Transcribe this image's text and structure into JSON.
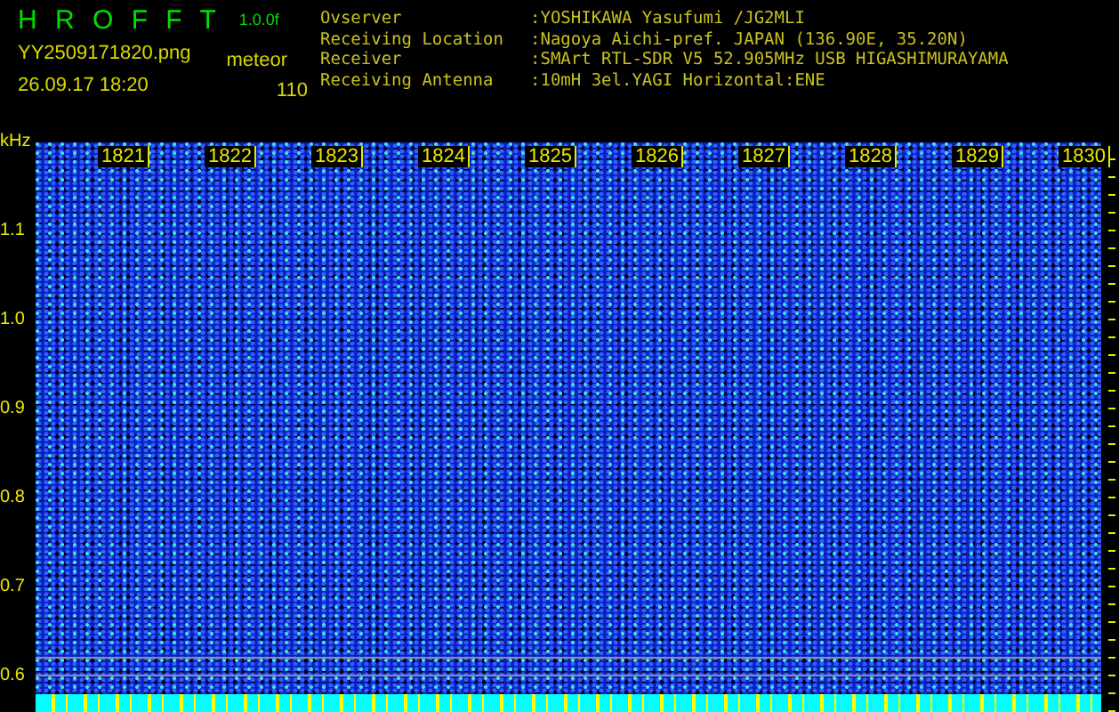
{
  "app": {
    "title": "H R O F F T",
    "version": "1.0.0f",
    "filename": "YY2509171820.png",
    "mode": "meteor",
    "datetime": "26.09.17 18:20",
    "count": "110"
  },
  "info": [
    {
      "label": "Ovserver",
      "value": ":YOSHIKAWA Yasufumi /JG2MLI"
    },
    {
      "label": "Receiving Location",
      "value": ":Nagoya Aichi-pref. JAPAN (136.90E, 35.20N)"
    },
    {
      "label": "Receiver",
      "value": ":SMArt RTL-SDR V5 52.905MHz USB HIGASHIMURAYAMA"
    },
    {
      "label": "Receiving Antenna",
      "value": ":10mH 3el.YAGI Horizontal:ENE"
    }
  ],
  "spectrogram": {
    "unit": "kHz",
    "time_labels": [
      "1821",
      "1822",
      "1823",
      "1824",
      "1825",
      "1826",
      "1827",
      "1828",
      "1829",
      "1830"
    ],
    "freq_labels": [
      "1.1",
      "1.0",
      "0.9",
      "0.8",
      "0.7",
      "0.6"
    ]
  }
}
